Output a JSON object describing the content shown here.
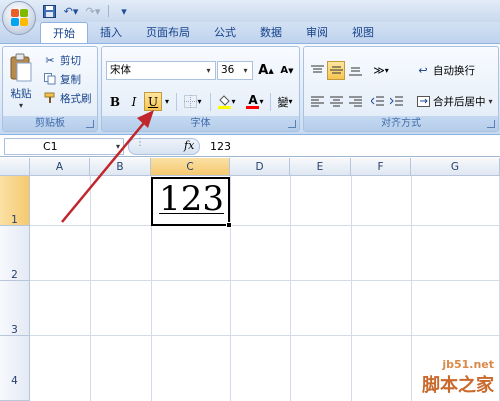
{
  "quick_access": {
    "icons": [
      "save-icon",
      "undo-icon",
      "redo-icon",
      "customize-icon"
    ]
  },
  "tabs": [
    "开始",
    "插入",
    "页面布局",
    "公式",
    "数据",
    "审阅",
    "视图"
  ],
  "clipboard": {
    "paste_label": "粘贴",
    "cut_label": "剪切",
    "copy_label": "复制",
    "format_painter_label": "格式刷",
    "group_label": "剪贴板"
  },
  "font": {
    "font_name": "宋体",
    "font_size": "36",
    "bold_glyph": "B",
    "italic_glyph": "I",
    "underline_glyph": "U",
    "font_color_glyph": "A",
    "pinyin_glyph": "變",
    "grow_glyph": "A",
    "shrink_glyph": "A",
    "group_label": "字体",
    "underline_active": true,
    "fill_color": "#ffff00",
    "font_color": "#ff0000"
  },
  "alignment": {
    "wrap_text_label": "自动换行",
    "merge_center_label": "合并后居中",
    "group_label": "对齐方式"
  },
  "formula_bar": {
    "name_box": "C1",
    "fx_label": "fx",
    "formula_value": "123"
  },
  "sheet": {
    "columns": [
      "A",
      "B",
      "C",
      "D",
      "E",
      "F",
      "G"
    ],
    "rows": [
      "1",
      "2",
      "3",
      "4"
    ],
    "selected_column": "C",
    "selected_row": "1",
    "cell_c1_value": "123"
  },
  "watermark": {
    "url": "jb51.net",
    "name": "脚本之家"
  },
  "colors": {
    "arrow": "#c0262b",
    "accent": "#15428b"
  }
}
